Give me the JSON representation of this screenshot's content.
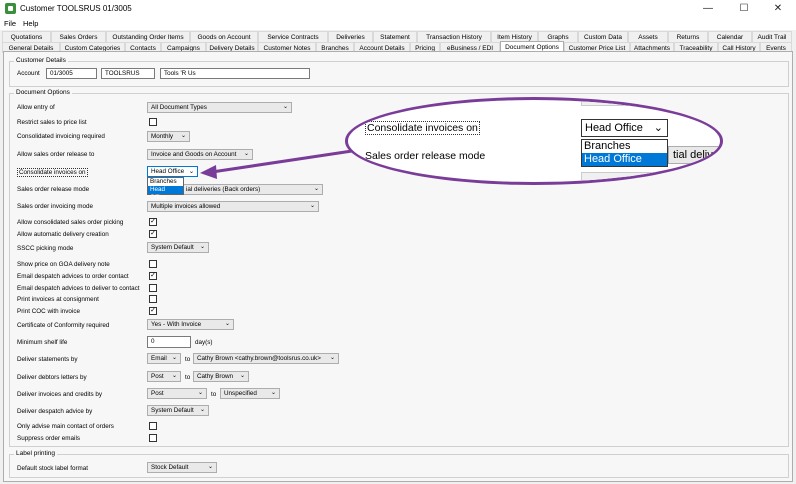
{
  "window": {
    "title": "Customer TOOLSRUS 01/3005",
    "minimize": "—",
    "maximize": "☐",
    "close": "✕"
  },
  "menu": [
    "File",
    "Help"
  ],
  "tabs_row1": [
    "Quotations",
    "Sales Orders",
    "Outstanding Order Items",
    "Goods on Account",
    "Service Contracts",
    "Deliveries",
    "Statement",
    "Transaction History",
    "Item History",
    "Graphs",
    "Custom Data",
    "Assets",
    "Returns",
    "Calendar",
    "Audit Trail"
  ],
  "tabs_row2": [
    "General Details",
    "Custom Categories",
    "Contacts",
    "Campaigns",
    "Delivery Details",
    "Customer Notes",
    "Branches",
    "Account Details",
    "Pricing",
    "eBusiness / EDI",
    "Document Options",
    "Customer Price List",
    "Attachments",
    "Traceability",
    "Call History",
    "Events"
  ],
  "active_tab": "Document Options",
  "customer_details": {
    "title": "Customer Details",
    "account_label": "Account",
    "account": "01/3005",
    "code": "TOOLSRUS",
    "name": "Tools 'R Us"
  },
  "document_options": {
    "title": "Document Options",
    "allow_entry_label": "Allow entry of",
    "allow_entry_value": "All Document Types",
    "restrict_label": "Restrict sales to price list",
    "consolidated_label": "Consolidated invoicing required",
    "consolidated_value": "Monthly",
    "release_to_label": "Allow sales order release to",
    "release_to_value": "Invoice and Goods on Account",
    "consolidate_inv_label": "Consolidate invoices on",
    "consolidate_inv_value": "Head Office",
    "consolidate_options": [
      "Branches",
      "Head Office"
    ],
    "release_mode_label": "Sales order release mode",
    "release_mode_value": "ial deliveries (Back orders)",
    "invoicing_mode_label": "Sales order invoicing mode",
    "invoicing_mode_value": "Multiple invoices allowed",
    "allow_consol_picking_label": "Allow consolidated sales order picking",
    "allow_auto_delivery_label": "Allow automatic delivery creation",
    "sscc_label": "SSCC picking mode",
    "sscc_value": "System Default",
    "show_price_label": "Show price on GOA delivery note",
    "email_order_label": "Email despatch advices to order contact",
    "email_deliver_label": "Email despatch advices to deliver to contact",
    "print_consign_label": "Print invoices at consignment",
    "print_coc_label": "Print COC with invoice",
    "coc_label": "Certificate of Conformity required",
    "coc_value": "Yes - With Invoice",
    "min_shelf_label": "Minimum shelf life",
    "min_shelf_value": "0",
    "min_shelf_unit": "day(s)",
    "deliver_statements_label": "Deliver statements by",
    "deliver_statements_method": "Email",
    "to": "to",
    "deliver_statements_to": "Cathy Brown <cathy.brown@toolsrus.co.uk>",
    "deliver_debtors_label": "Deliver debtors letters by",
    "deliver_debtors_method": "Post",
    "deliver_debtors_to": "Cathy Brown",
    "deliver_invoices_label": "Deliver invoices and credits by",
    "deliver_invoices_method": "Post",
    "deliver_invoices_to": "Unspecified",
    "deliver_despatch_label": "Deliver despatch advice by",
    "deliver_despatch_value": "System Default",
    "only_advise_label": "Only advise main contact of orders",
    "suppress_label": "Suppress order emails"
  },
  "label_printing": {
    "title": "Label printing",
    "default_stock_label": "Default stock label format",
    "default_stock_value": "Stock Default"
  },
  "zoom": {
    "consolidate_label": "Consolidate invoices on",
    "value": "Head Office",
    "options": [
      "Branches",
      "Head Office"
    ],
    "release_label": "Sales order release mode",
    "partial_text": "tial deliv"
  },
  "colors": {
    "accent": "#0078d7",
    "callout": "#7a3c99"
  }
}
